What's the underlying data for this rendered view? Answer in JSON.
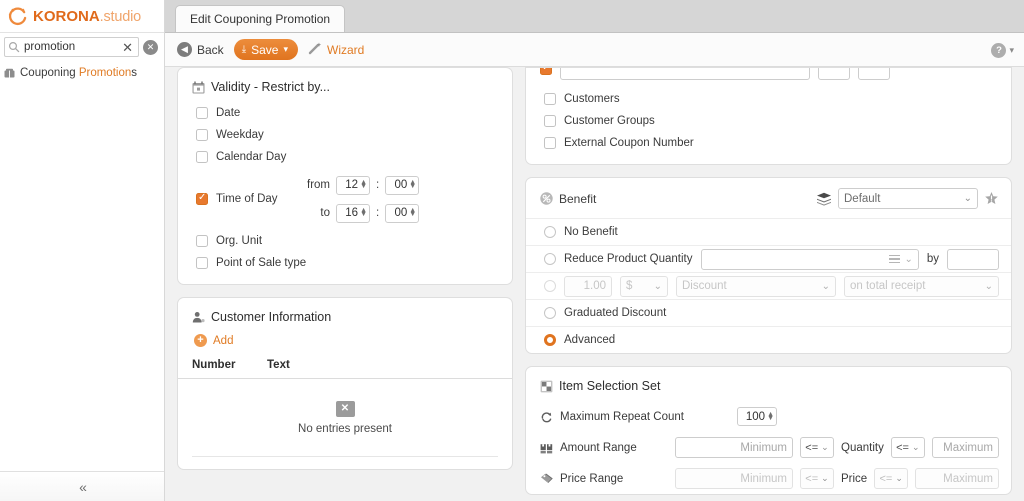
{
  "brand": {
    "name_bold": "KORONA",
    "name_light": ".studio"
  },
  "sidebar": {
    "search": {
      "value": "promotion",
      "clear_label": "✕",
      "reset_label": "✕"
    },
    "tree": [
      {
        "prefix": "Couponing ",
        "match": "Promotion",
        "suffix": "s"
      }
    ],
    "collapse_label": "«"
  },
  "tabs": [
    {
      "label": "Edit Couponing Promotion"
    }
  ],
  "toolbar": {
    "back_label": "Back",
    "save_label": "Save",
    "wizard_label": "Wizard",
    "help_label": "?"
  },
  "validity": {
    "title": "Validity - Restrict by...",
    "options": [
      {
        "label": "Date",
        "checked": false
      },
      {
        "label": "Weekday",
        "checked": false
      },
      {
        "label": "Calendar Day",
        "checked": false
      }
    ],
    "time_of_day": {
      "label": "Time of Day",
      "checked": true,
      "from_label": "from",
      "from_hour": "12",
      "from_minute": "00",
      "to_label": "to",
      "to_hour": "16",
      "to_minute": "00",
      "separator": ":"
    },
    "options_after": [
      {
        "label": "Org. Unit",
        "checked": false
      },
      {
        "label": "Point of Sale type",
        "checked": false
      }
    ]
  },
  "customer_information": {
    "title": "Customer Information",
    "add_label": "Add",
    "columns": [
      "Number",
      "Text"
    ],
    "empty_label": "No entries present"
  },
  "restrictions": {
    "options": [
      {
        "label": "Customers",
        "checked": false
      },
      {
        "label": "Customer Groups",
        "checked": false
      },
      {
        "label": "External Coupon Number",
        "checked": false
      }
    ]
  },
  "benefit": {
    "title": "Benefit",
    "profile_value": "Default",
    "options": [
      {
        "label": "No Benefit",
        "selected": false
      },
      {
        "label": "Reduce Product Quantity",
        "selected": false
      },
      {
        "label": "Graduated Discount",
        "selected": false
      },
      {
        "label": "Advanced",
        "selected": true
      }
    ],
    "reduce_by_label": "by",
    "discount_row": {
      "amount": "1.00",
      "currency": "$",
      "type": "Discount",
      "scope": "on total receipt"
    }
  },
  "item_selection_set": {
    "title": "Item Selection Set",
    "max_repeat_label": "Maximum Repeat Count",
    "max_repeat_value": "100",
    "amount_range": {
      "label": "Amount Range",
      "min_placeholder": "Minimum",
      "op_left": "<=",
      "middle": "Quantity",
      "op_right": "<=",
      "max_placeholder": "Maximum"
    },
    "price_range": {
      "label": "Price Range",
      "min_placeholder": "Minimum",
      "op_left": "<=",
      "middle": "Price",
      "op_right": "<=",
      "max_placeholder": "Maximum"
    }
  },
  "colors": {
    "accent": "#e07b24",
    "save": "#e8822f",
    "checked": "#e8792e"
  }
}
